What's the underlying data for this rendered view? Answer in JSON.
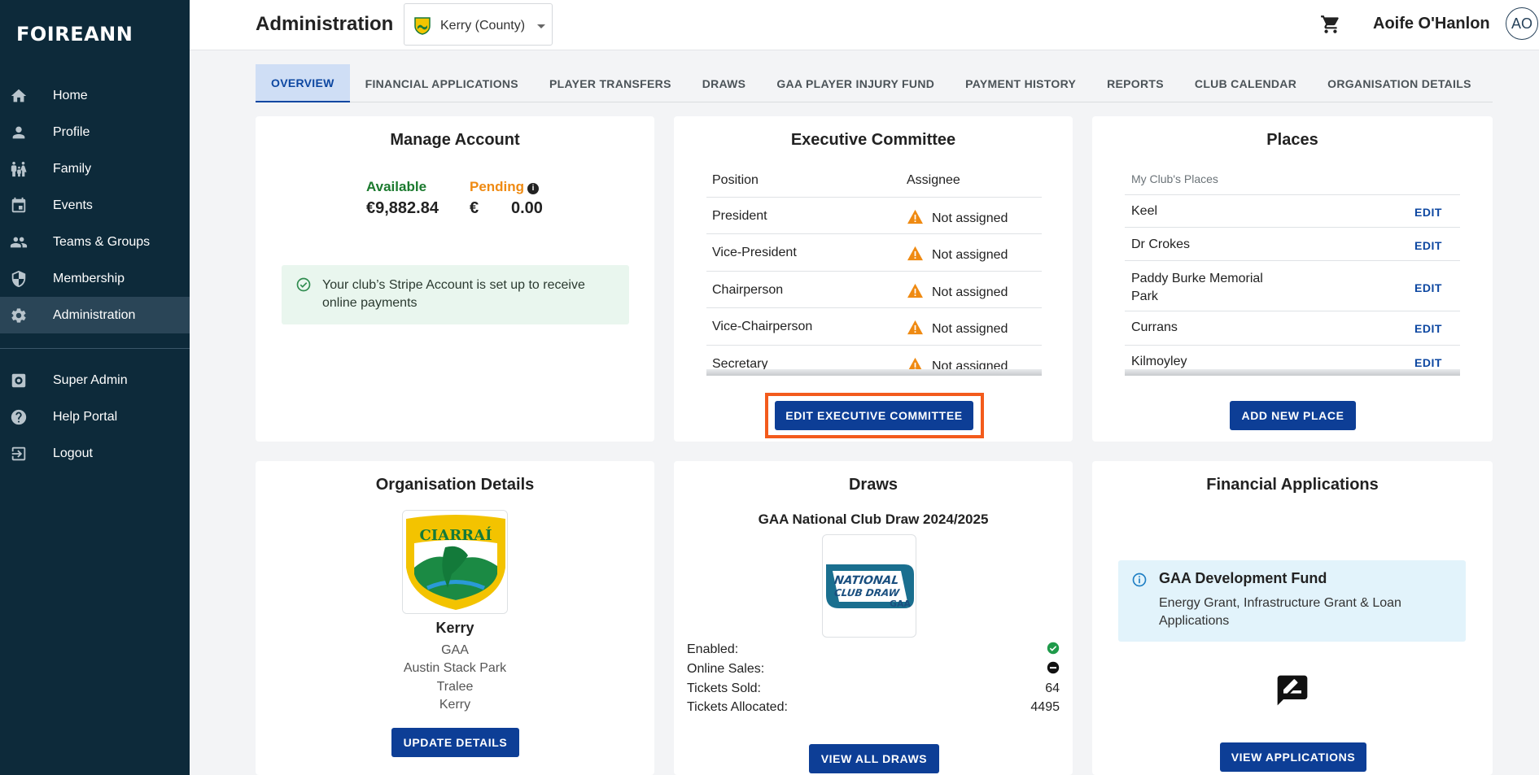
{
  "brand": "FOIREANN",
  "sidebar": {
    "items": [
      {
        "label": "Home",
        "icon": "home-icon"
      },
      {
        "label": "Profile",
        "icon": "person-icon"
      },
      {
        "label": "Family",
        "icon": "family-icon"
      },
      {
        "label": "Events",
        "icon": "calendar-icon"
      },
      {
        "label": "Teams & Groups",
        "icon": "groups-icon"
      },
      {
        "label": "Membership",
        "icon": "shield-icon"
      },
      {
        "label": "Administration",
        "icon": "gear-icon",
        "active": true
      }
    ],
    "secondary": [
      {
        "label": "Super Admin",
        "icon": "admin-gear-icon"
      },
      {
        "label": "Help Portal",
        "icon": "help-icon"
      },
      {
        "label": "Logout",
        "icon": "logout-icon"
      }
    ]
  },
  "header": {
    "title": "Administration",
    "org_select": "Kerry (County)",
    "user_name": "Aoife O'Hanlon",
    "avatar_initials": "AO"
  },
  "tabs": [
    "OVERVIEW",
    "FINANCIAL APPLICATIONS",
    "PLAYER TRANSFERS",
    "DRAWS",
    "GAA PLAYER INJURY FUND",
    "PAYMENT HISTORY",
    "REPORTS",
    "CLUB CALENDAR",
    "ORGANISATION DETAILS"
  ],
  "manage_account": {
    "title": "Manage Account",
    "available_label": "Available",
    "available_value": "€9,882.84",
    "pending_label": "Pending",
    "pending_currency": "€",
    "pending_value": "0.00",
    "stripe_message": "Your club’s Stripe Account is set up to receive online payments",
    "colors": {
      "available": "#1b7a2e",
      "pending": "#ef8a12"
    }
  },
  "executive": {
    "title": "Executive Committee",
    "col_position": "Position",
    "col_assignee": "Assignee",
    "rows": [
      {
        "position": "President",
        "assignee": "Not assigned"
      },
      {
        "position": "Vice-President",
        "assignee": "Not assigned"
      },
      {
        "position": "Chairperson",
        "assignee": "Not assigned"
      },
      {
        "position": "Vice-Chairperson",
        "assignee": "Not assigned"
      },
      {
        "position": "Secretary",
        "assignee": "Not assigned"
      }
    ],
    "button": "EDIT EXECUTIVE COMMITTEE"
  },
  "places": {
    "title": "Places",
    "subtitle": "My Club's Places",
    "edit_label": "EDIT",
    "rows": [
      "Keel",
      "Dr Crokes",
      "Paddy Burke Memorial Park",
      "Currans",
      "Kilmoyley"
    ],
    "button": "ADD NEW PLACE"
  },
  "org_details": {
    "title": "Organisation Details",
    "logo_text": "CIARRAÍ",
    "name": "Kerry",
    "lines": [
      "GAA",
      "Austin Stack Park",
      "Tralee",
      "Kerry"
    ],
    "button": "UPDATE DETAILS"
  },
  "draws": {
    "title": "Draws",
    "draw_name": "GAA National Club Draw 2024/2025",
    "logo_line1": "NATIONAL",
    "logo_line2": "CLUB DRAW",
    "logo_mark": "GAA",
    "enabled_label": "Enabled:",
    "online_label": "Online Sales:",
    "sold_label": "Tickets Sold:",
    "sold_value": "64",
    "allocated_label": "Tickets Allocated:",
    "allocated_value": "4495",
    "button": "VIEW ALL DRAWS"
  },
  "financial": {
    "title": "Financial Applications",
    "fund_title": "GAA Development Fund",
    "fund_desc": "Energy Grant, Infrastructure Grant & Loan Applications",
    "button": "VIEW APPLICATIONS"
  }
}
